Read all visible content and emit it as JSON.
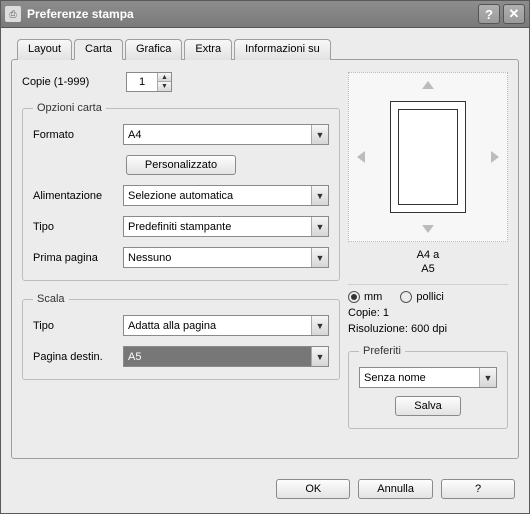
{
  "window": {
    "title": "Preferenze stampa"
  },
  "tabs": {
    "layout": "Layout",
    "carta": "Carta",
    "grafica": "Grafica",
    "extra": "Extra",
    "info": "Informazioni su"
  },
  "copies": {
    "label": "Copie (1-999)",
    "value": "1"
  },
  "paper_options": {
    "legend": "Opzioni carta",
    "format_label": "Formato",
    "format_value": "A4",
    "custom_btn": "Personalizzato",
    "feed_label": "Alimentazione",
    "feed_value": "Selezione automatica",
    "type_label": "Tipo",
    "type_value": "Predefiniti stampante",
    "firstpage_label": "Prima pagina",
    "firstpage_value": "Nessuno"
  },
  "scale": {
    "legend": "Scala",
    "type_label": "Tipo",
    "type_value": "Adatta alla pagina",
    "dest_label": "Pagina destin.",
    "dest_value": "A5"
  },
  "preview": {
    "line1": "A4 a",
    "line2": "A5"
  },
  "units": {
    "mm": "mm",
    "inches": "pollici"
  },
  "info": {
    "copies": "Copie: 1",
    "resolution": "Risoluzione: 600 dpi"
  },
  "favorites": {
    "legend": "Preferiti",
    "value": "Senza nome",
    "save": "Salva"
  },
  "buttons": {
    "ok": "OK",
    "cancel": "Annulla",
    "help": "?"
  }
}
